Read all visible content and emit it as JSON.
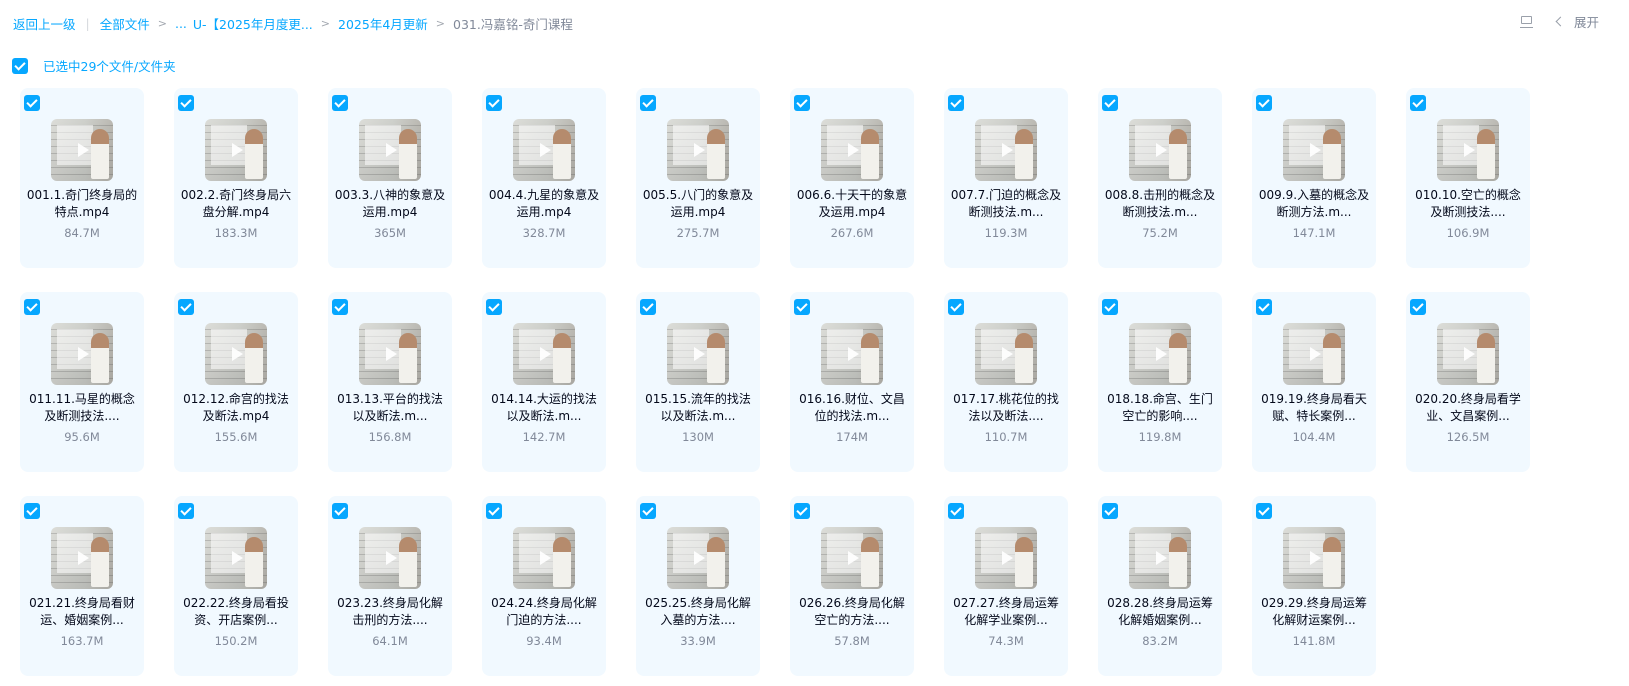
{
  "breadcrumb": {
    "back": "返回上一级",
    "root": "全部文件",
    "ellipsis": "...",
    "folder1": "U-【2025年月度更...",
    "folder2": "2025年4月更新",
    "current": "031.冯嘉铭-奇门课程"
  },
  "toolbar": {
    "expand_label": "展开"
  },
  "selection": {
    "text": "已选中29个文件/文件夹"
  },
  "colors": {
    "accent": "#06a7ff",
    "tile_bg": "#f1f9ff"
  },
  "icons": {
    "view": "layout-icon",
    "expand": "chevron-left-icon",
    "play": "play-icon",
    "check": "checkbox-checked-icon"
  },
  "files": [
    {
      "name": "001.1.奇门终身局的特点.mp4",
      "size": "84.7M"
    },
    {
      "name": "002.2.奇门终身局六盘分解.mp4",
      "size": "183.3M"
    },
    {
      "name": "003.3.八神的象意及运用.mp4",
      "size": "365M"
    },
    {
      "name": "004.4.九星的象意及运用.mp4",
      "size": "328.7M"
    },
    {
      "name": "005.5.八门的象意及运用.mp4",
      "size": "275.7M"
    },
    {
      "name": "006.6.十天干的象意及运用.mp4",
      "size": "267.6M"
    },
    {
      "name": "007.7.门迫的概念及断测技法.m...",
      "size": "119.3M"
    },
    {
      "name": "008.8.击刑的概念及断测技法.m...",
      "size": "75.2M"
    },
    {
      "name": "009.9.入墓的概念及断测方法.m...",
      "size": "147.1M"
    },
    {
      "name": "010.10.空亡的概念及断测技法....",
      "size": "106.9M"
    },
    {
      "name": "011.11.马星的概念及断测技法....",
      "size": "95.6M"
    },
    {
      "name": "012.12.命宫的找法及断法.mp4",
      "size": "155.6M"
    },
    {
      "name": "013.13.平台的找法以及断法.m...",
      "size": "156.8M"
    },
    {
      "name": "014.14.大运的找法以及断法.m...",
      "size": "142.7M"
    },
    {
      "name": "015.15.流年的找法以及断法.m...",
      "size": "130M"
    },
    {
      "name": "016.16.财位、文昌位的找法.m...",
      "size": "174M"
    },
    {
      "name": "017.17.桃花位的找法以及断法....",
      "size": "110.7M"
    },
    {
      "name": "018.18.命宫、生门空亡的影响....",
      "size": "119.8M"
    },
    {
      "name": "019.19.终身局看天赋、特长案例...",
      "size": "104.4M"
    },
    {
      "name": "020.20.终身局看学业、文昌案例...",
      "size": "126.5M"
    },
    {
      "name": "021.21.终身局看财运、婚姻案例...",
      "size": "163.7M"
    },
    {
      "name": "022.22.终身局看投资、开店案例...",
      "size": "150.2M"
    },
    {
      "name": "023.23.终身局化解击刑的方法....",
      "size": "64.1M"
    },
    {
      "name": "024.24.终身局化解门迫的方法....",
      "size": "93.4M"
    },
    {
      "name": "025.25.终身局化解入墓的方法....",
      "size": "33.9M"
    },
    {
      "name": "026.26.终身局化解空亡的方法....",
      "size": "57.8M"
    },
    {
      "name": "027.27.终身局运筹化解学业案例...",
      "size": "74.3M"
    },
    {
      "name": "028.28.终身局运筹化解婚姻案例...",
      "size": "83.2M"
    },
    {
      "name": "029.29.终身局运筹化解财运案例...",
      "size": "141.8M"
    }
  ]
}
